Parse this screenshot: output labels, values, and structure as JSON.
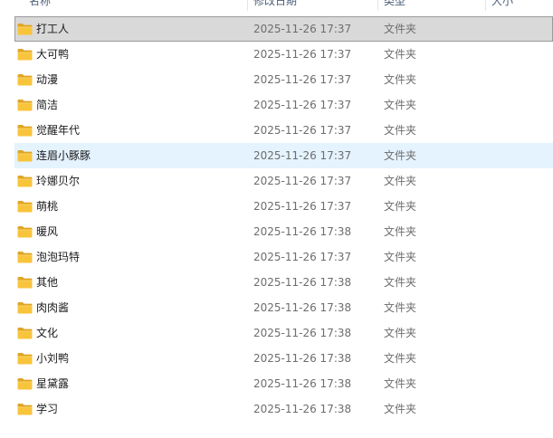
{
  "columns": {
    "name": "名称",
    "date": "修改日期",
    "type": "类型",
    "size": "大小"
  },
  "rows": [
    {
      "name": "打工人",
      "date": "2025-11-26 17:37",
      "type": "文件夹",
      "icon": "folder-icon",
      "state": "selected"
    },
    {
      "name": "大可鸭",
      "date": "2025-11-26 17:37",
      "type": "文件夹",
      "icon": "folder-icon",
      "state": ""
    },
    {
      "name": "动漫",
      "date": "2025-11-26 17:37",
      "type": "文件夹",
      "icon": "folder-icon",
      "state": ""
    },
    {
      "name": "简洁",
      "date": "2025-11-26 17:37",
      "type": "文件夹",
      "icon": "folder-icon",
      "state": ""
    },
    {
      "name": "觉醒年代",
      "date": "2025-11-26 17:37",
      "type": "文件夹",
      "icon": "folder-icon",
      "state": ""
    },
    {
      "name": "连眉小豚豚",
      "date": "2025-11-26 17:37",
      "type": "文件夹",
      "icon": "folder-icon",
      "state": "hover"
    },
    {
      "name": "玲娜贝尔",
      "date": "2025-11-26 17:37",
      "type": "文件夹",
      "icon": "folder-icon",
      "state": ""
    },
    {
      "name": "萌桃",
      "date": "2025-11-26 17:37",
      "type": "文件夹",
      "icon": "folder-icon",
      "state": ""
    },
    {
      "name": "暖风",
      "date": "2025-11-26 17:38",
      "type": "文件夹",
      "icon": "folder-icon",
      "state": ""
    },
    {
      "name": "泡泡玛特",
      "date": "2025-11-26 17:37",
      "type": "文件夹",
      "icon": "folder-icon",
      "state": ""
    },
    {
      "name": "其他",
      "date": "2025-11-26 17:38",
      "type": "文件夹",
      "icon": "folder-icon",
      "state": ""
    },
    {
      "name": "肉肉酱",
      "date": "2025-11-26 17:38",
      "type": "文件夹",
      "icon": "folder-icon",
      "state": ""
    },
    {
      "name": "文化",
      "date": "2025-11-26 17:38",
      "type": "文件夹",
      "icon": "folder-icon",
      "state": ""
    },
    {
      "name": "小刘鸭",
      "date": "2025-11-26 17:38",
      "type": "文件夹",
      "icon": "folder-icon",
      "state": ""
    },
    {
      "name": "星黛露",
      "date": "2025-11-26 17:38",
      "type": "文件夹",
      "icon": "folder-icon",
      "state": ""
    },
    {
      "name": "学习",
      "date": "2025-11-26 17:38",
      "type": "文件夹",
      "icon": "folder-icon",
      "state": ""
    }
  ],
  "colors": {
    "selected_bg": "#d9d9d9",
    "hover_bg": "#e5f3ff",
    "folder_yellow": "#f8c43c"
  }
}
